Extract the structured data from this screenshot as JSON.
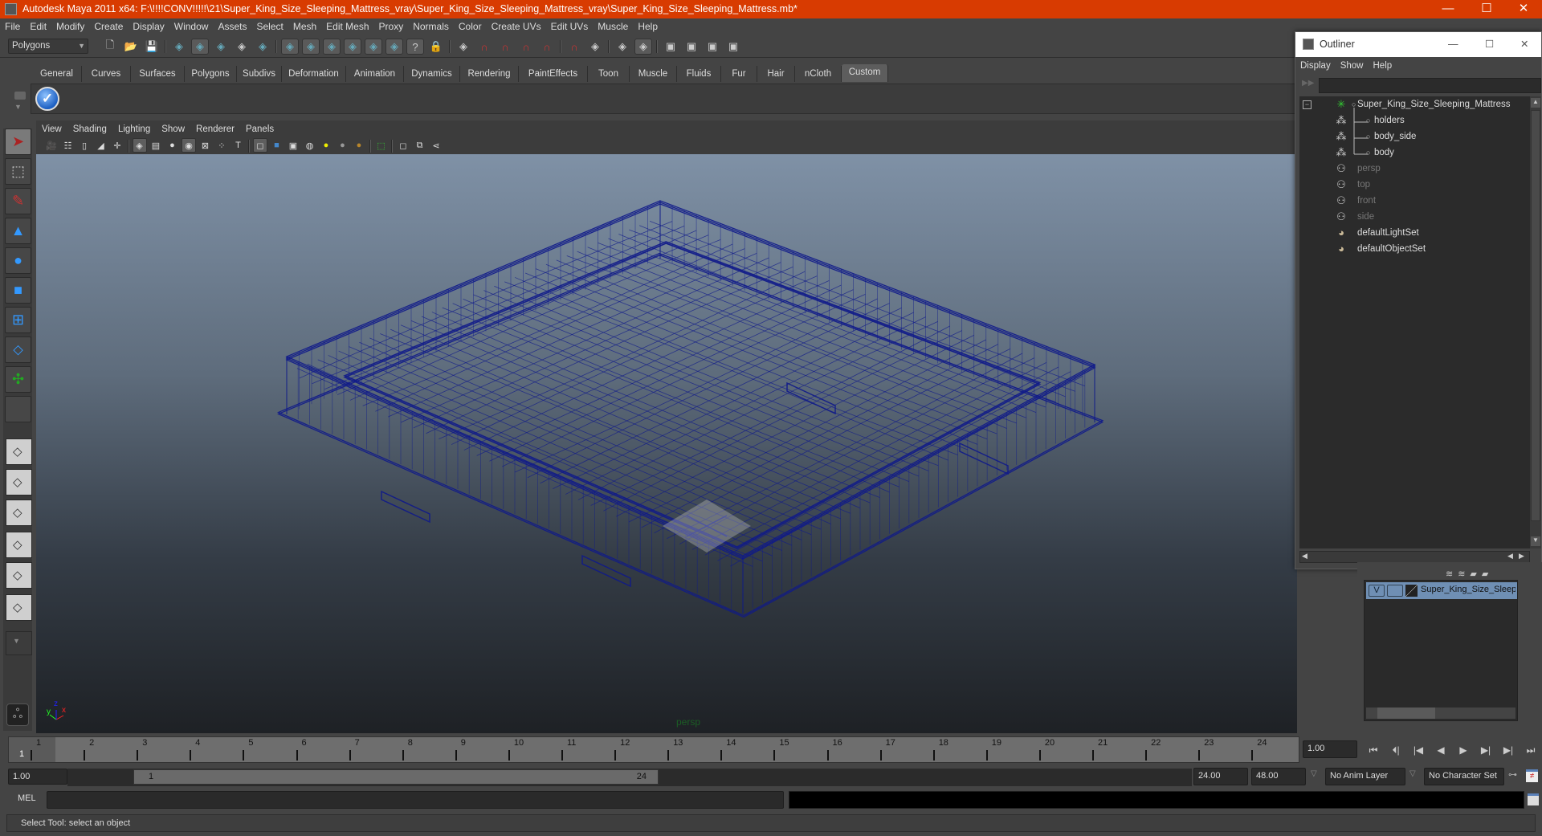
{
  "window": {
    "title": "Autodesk Maya 2011 x64: F:\\!!!!CONV!!!!!\\21\\Super_King_Size_Sleeping_Mattress_vray\\Super_King_Size_Sleeping_Mattress_vray\\Super_King_Size_Sleeping_Mattress.mb*",
    "controls": {
      "minimize": "—",
      "maximize": "☐",
      "close": "✕"
    }
  },
  "menubar": [
    "File",
    "Edit",
    "Modify",
    "Create",
    "Display",
    "Window",
    "Assets",
    "Select",
    "Mesh",
    "Edit Mesh",
    "Proxy",
    "Normals",
    "Color",
    "Create UVs",
    "Edit UVs",
    "Muscle",
    "Help"
  ],
  "statusline": {
    "mode": "Polygons",
    "icons": [
      "new-scene",
      "open-scene",
      "save-scene",
      "select-hierarchy",
      "select-object",
      "select-component",
      "lock-selection",
      "select-handle",
      "select-vertex",
      "select-edge",
      "select-face",
      "select-uv",
      "select-vertex-face",
      "select-misc",
      "question",
      "lock",
      "highlight-selection",
      "snap-grid",
      "snap-curve",
      "snap-point",
      "snap-view-plane",
      "snap-live",
      "input-ops",
      "output-ops",
      "construction-history",
      "render-view",
      "render-frame",
      "ipr-render",
      "render-settings"
    ]
  },
  "shelf": {
    "tabs": [
      "General",
      "Curves",
      "Surfaces",
      "Polygons",
      "Subdivs",
      "Deformation",
      "Animation",
      "Dynamics",
      "Rendering",
      "PaintEffects",
      "Toon",
      "Muscle",
      "Fluids",
      "Fur",
      "Hair",
      "nCloth",
      "Custom"
    ],
    "active_tab": "Custom",
    "items": [
      {
        "icon": "checkmark-icon"
      }
    ]
  },
  "toolbox": {
    "tools": [
      "select-tool",
      "lasso-tool",
      "paint-select-tool",
      "move-tool",
      "rotate-tool",
      "scale-tool",
      "universal-manipulator",
      "soft-mod-tool",
      "show-manipulator",
      "last-tool"
    ],
    "layouts": [
      "single-perspective",
      "four-view",
      "outliner-persp",
      "persp-graph",
      "hypershade-persp",
      "persp-outliner-graph",
      "layout-menu"
    ]
  },
  "viewport": {
    "menu": [
      "View",
      "Shading",
      "Lighting",
      "Show",
      "Renderer",
      "Panels"
    ],
    "camera": "persp",
    "axis": {
      "x": "x",
      "y": "y",
      "z": "z"
    },
    "wire_color": "#0f1a8a"
  },
  "timeline": {
    "ticks": [
      1,
      2,
      3,
      4,
      5,
      6,
      7,
      8,
      9,
      10,
      11,
      12,
      13,
      14,
      15,
      16,
      17,
      18,
      19,
      20,
      21,
      22,
      23,
      24
    ],
    "current_frame": "1",
    "current_time": "1.00",
    "start_time": "1.00",
    "playback_start": "1.00",
    "range_start": "1",
    "range_end": "24",
    "playback_end": "24.00",
    "end_time": "48.00",
    "anim_layer": "No Anim Layer",
    "character_set": "No Character Set",
    "playback_buttons": [
      "go-to-start",
      "step-back-frame",
      "step-back-key",
      "play-backward",
      "play-forward",
      "step-forward-key",
      "step-forward-frame",
      "go-to-end"
    ]
  },
  "command_line": {
    "label": "MEL",
    "value": "",
    "output": ""
  },
  "help_line": "Select Tool: select an object",
  "outliner": {
    "title": "Outliner",
    "menu": [
      "Display",
      "Show",
      "Help"
    ],
    "filter": "",
    "items": [
      {
        "label": "Super_King_Size_Sleeping_Mattress",
        "icon": "group-icon",
        "depth": 0,
        "dim": false
      },
      {
        "label": "holders",
        "icon": "mesh-icon",
        "depth": 1,
        "dim": false
      },
      {
        "label": "body_side",
        "icon": "mesh-icon",
        "depth": 1,
        "dim": false
      },
      {
        "label": "body",
        "icon": "mesh-icon",
        "depth": 1,
        "dim": false
      },
      {
        "label": "persp",
        "icon": "camera-icon",
        "depth": 0,
        "dim": true
      },
      {
        "label": "top",
        "icon": "camera-icon",
        "depth": 0,
        "dim": true
      },
      {
        "label": "front",
        "icon": "camera-icon",
        "depth": 0,
        "dim": true
      },
      {
        "label": "side",
        "icon": "camera-icon",
        "depth": 0,
        "dim": true
      },
      {
        "label": "defaultLightSet",
        "icon": "set-icon",
        "depth": 0,
        "dim": false
      },
      {
        "label": "defaultObjectSet",
        "icon": "set-icon",
        "depth": 0,
        "dim": false
      }
    ]
  },
  "layer_editor": {
    "layers": [
      {
        "visible": "V",
        "name": "Super_King_Size_Sleeping"
      }
    ]
  },
  "colors": {
    "titlebar": "#d83b01",
    "selection": "#6f8fb4",
    "wireframe": "#0f1a8a"
  }
}
